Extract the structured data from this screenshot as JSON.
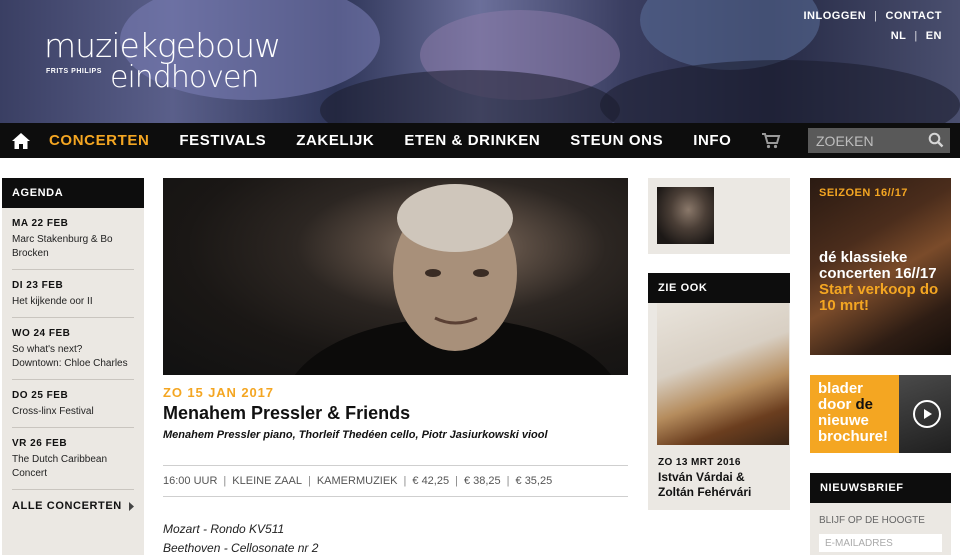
{
  "header": {
    "logo": {
      "line1": "muziekgebouw",
      "small": "FRITS PHILIPS",
      "line2": "eindhoven"
    },
    "top_links": {
      "login": "INLOGGEN",
      "contact": "CONTACT",
      "lang_nl": "NL",
      "lang_en": "EN"
    }
  },
  "nav": {
    "items": [
      {
        "label": "CONCERTEN",
        "active": true
      },
      {
        "label": "FESTIVALS",
        "active": false
      },
      {
        "label": "ZAKELIJK",
        "active": false
      },
      {
        "label": "ETEN & DRINKEN",
        "active": false
      },
      {
        "label": "STEUN ONS",
        "active": false
      },
      {
        "label": "INFO",
        "active": false
      }
    ],
    "search_placeholder": "ZOEKEN"
  },
  "agenda": {
    "heading": "AGENDA",
    "entries": [
      {
        "date": "MA 22 FEB",
        "title": "Marc Stakenburg & Bo Brocken"
      },
      {
        "date": "DI 23 FEB",
        "title": "Het kijkende oor II"
      },
      {
        "date": "WO 24 FEB",
        "title": "So what's next? Downtown: Chloe Charles"
      },
      {
        "date": "DO 25 FEB",
        "title": "Cross-linx Festival"
      },
      {
        "date": "VR 26 FEB",
        "title": "The Dutch Caribbean Concert"
      }
    ],
    "all_link": "ALLE CONCERTEN"
  },
  "event": {
    "date": "ZO 15 JAN 2017",
    "title": "Menahem Pressler & Friends",
    "performers": "Menahem Pressler piano, Thorleif Thedéen cello, Piotr Jasiurkowski viool",
    "meta": [
      "16:00 UUR",
      "KLEINE ZAAL",
      "KAMERMUZIEK",
      "€ 42,25",
      "€ 38,25",
      "€ 35,25"
    ],
    "program": [
      "Mozart - Rondo KV511",
      "Beethoven - Cellosonate nr 2"
    ]
  },
  "zie_ook": {
    "heading": "ZIE OOK",
    "date": "ZO 13 MRT 2016",
    "title": "István Várdai & Zoltán Fehérvári"
  },
  "promo_season": {
    "label": "SEIZOEN 16//17",
    "text_white": "dé klassieke concerten 16//17 ",
    "text_orange": "Start verkoop do 10 mrt!"
  },
  "promo_brochure": {
    "w1": "blader",
    "w2": "door ",
    "w3": "de",
    "w4": "nieuwe",
    "w5": "brochure!"
  },
  "newsletter": {
    "heading": "NIEUWSBRIEF",
    "label": "BLIJF OP DE HOOGTE",
    "placeholder": "E-MAILADRES"
  },
  "colors": {
    "accent": "#f4a622",
    "nav_bg": "#0d0d0d",
    "panel_bg": "#ebe8e3"
  }
}
